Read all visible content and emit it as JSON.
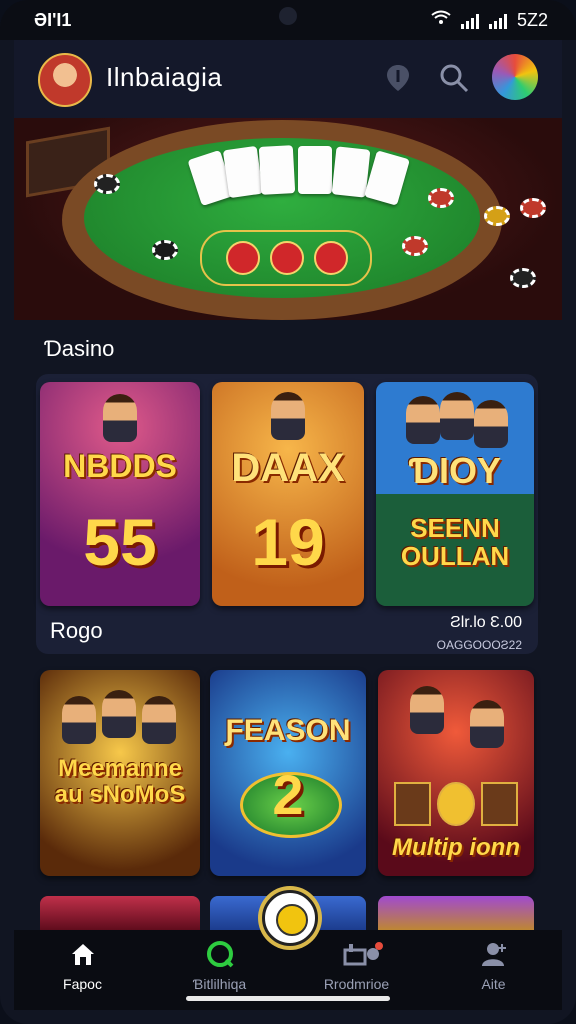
{
  "status": {
    "time": "ƏI'I1",
    "battery": "5Z2"
  },
  "header": {
    "title": "Ilnbaiagia"
  },
  "section": {
    "title": "Ɗasino"
  },
  "cards_row1": [
    {
      "title": "NBDDS",
      "number": "55"
    },
    {
      "title": "DAAX",
      "number": "19"
    },
    {
      "title": "ƊIOY",
      "subtitle": "SEENN OULLAN"
    }
  ],
  "row1_footer": {
    "label": "Rogo",
    "price": "Ƨlr.lo  Ɛ.00",
    "price_sub": "OAGGOOOƧ22"
  },
  "cards_row2": [
    {
      "title": "Meemanne au sNoMoS"
    },
    {
      "title": "ƑEASON",
      "number": "2"
    },
    {
      "title": "Multip ionn"
    }
  ],
  "nav": [
    {
      "label": "Fapoc",
      "icon": "home-icon",
      "active": true
    },
    {
      "label": "Ɓitlilhiqa",
      "icon": "games-icon",
      "active": false
    },
    {
      "label": "Rrodmrioe",
      "icon": "promotions-icon",
      "active": false
    },
    {
      "label": "Aite",
      "icon": "profile-icon",
      "active": false
    }
  ],
  "colors": {
    "background": "#111522",
    "accent": "#ffd84a",
    "felt": "#1b7a27"
  }
}
